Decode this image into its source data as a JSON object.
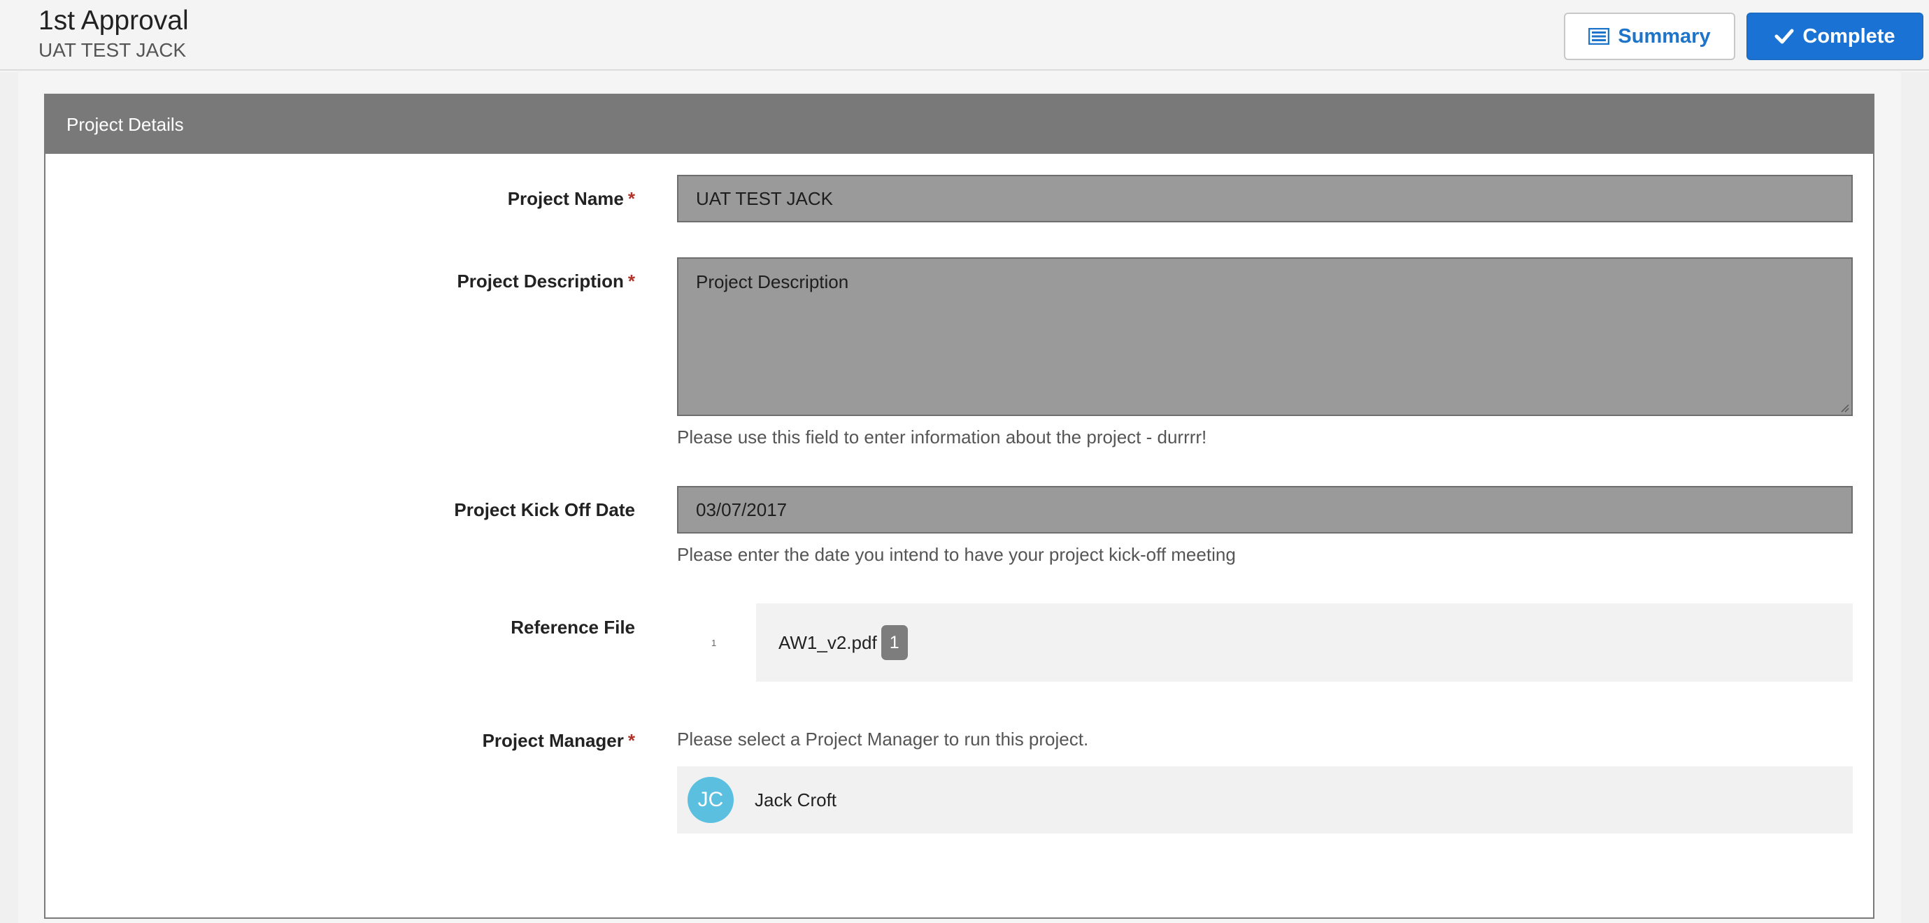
{
  "header": {
    "title": "1st Approval",
    "subtitle": "UAT TEST JACK",
    "summary_label": "Summary",
    "complete_label": "Complete",
    "summary_icon": "list-icon",
    "complete_icon": "check-icon"
  },
  "panel": {
    "title": "Project Details"
  },
  "form": {
    "project_name": {
      "label": "Project Name",
      "required": "*",
      "value": "UAT TEST JACK"
    },
    "project_description": {
      "label": "Project Description",
      "required": "*",
      "value": "Project Description",
      "help": "Please use this field to enter information about the project - durrrr!"
    },
    "kick_off_date": {
      "label": "Project Kick Off Date",
      "value": "03/07/2017",
      "help": "Please enter the date you intend to have your project kick-off meeting"
    },
    "reference_file": {
      "label": "Reference File",
      "index": "1",
      "file_name": "AW1_v2.pdf",
      "badge": "1"
    },
    "project_manager": {
      "label": "Project Manager",
      "required": "*",
      "help": "Please select a Project Manager to run this project.",
      "initials": "JC",
      "name": "Jack Croft"
    }
  },
  "colors": {
    "accent": "#1a73d4",
    "panel_header": "#797979",
    "avatar": "#5bc0e0",
    "required": "#b0342a"
  }
}
